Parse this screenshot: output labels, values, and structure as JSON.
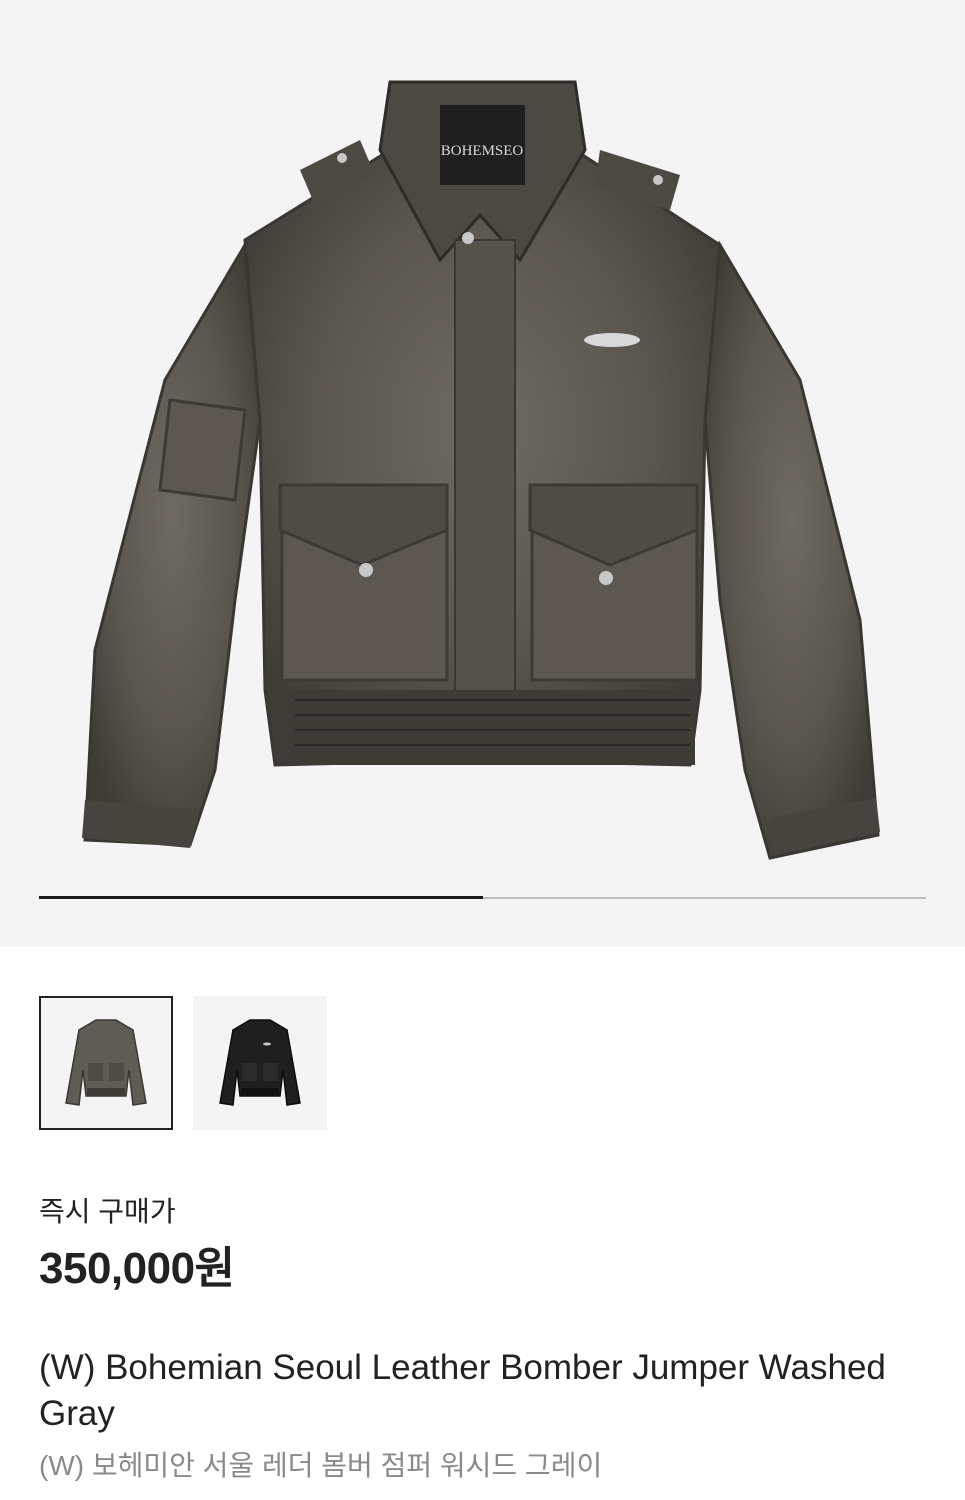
{
  "hero": {
    "brand_tag": "BOHEMSEO",
    "image_label": "jacket-washed-gray"
  },
  "carousel": {
    "progress": 0.5
  },
  "thumbnails": [
    {
      "color": "washed-gray",
      "selected": true
    },
    {
      "color": "black",
      "selected": false
    }
  ],
  "product": {
    "price_label": "즉시 구매가",
    "price": "350,000원",
    "title": "(W) Bohemian Seoul Leather Bomber Jumper Washed Gray",
    "subtitle": "(W) 보헤미안 서울 레더 봄버 점퍼 워시드 그레이"
  },
  "colors": {
    "hero_bg": "#f4f4f4",
    "jacket_gray": "#5f5b55",
    "jacket_black": "#1f1f1f",
    "text_primary": "#222222",
    "text_secondary": "#8a8a8a"
  }
}
